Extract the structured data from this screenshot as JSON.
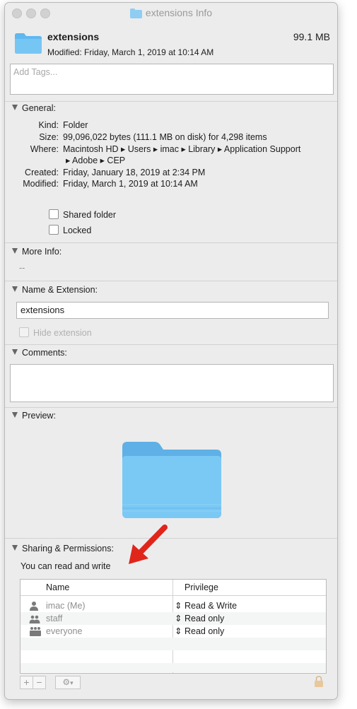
{
  "window": {
    "title": "extensions Info"
  },
  "header": {
    "name": "extensions",
    "size": "99.1 MB",
    "modified": "Modified: Friday, March 1, 2019 at 10:14 AM",
    "tags_placeholder": "Add Tags..."
  },
  "general": {
    "heading": "General:",
    "rows": [
      {
        "label": "Kind:",
        "value": "Folder"
      },
      {
        "label": "Size:",
        "value": "99,096,022 bytes (111.1 MB on disk) for 4,298 items"
      },
      {
        "label": "Where:",
        "value": "Macintosh HD ▸ Users ▸ imac ▸ Library ▸ Application Support",
        "value2": "▸ Adobe ▸ CEP"
      },
      {
        "label": "Created:",
        "value": "Friday, January 18, 2019 at 2:34 PM"
      },
      {
        "label": "Modified:",
        "value": "Friday, March 1, 2019 at 10:14 AM"
      }
    ],
    "shared_folder": "Shared folder",
    "locked": "Locked"
  },
  "more_info": {
    "heading": "More Info:",
    "value": "--"
  },
  "name_ext": {
    "heading": "Name & Extension:",
    "name_value": "extensions",
    "hide_extension": "Hide extension"
  },
  "comments": {
    "heading": "Comments:"
  },
  "preview": {
    "heading": "Preview:"
  },
  "sharing": {
    "heading": "Sharing & Permissions:",
    "summary": "You can read and write",
    "columns": [
      "Name",
      "Privilege"
    ],
    "rows": [
      {
        "name": "imac (Me)",
        "privilege": "Read & Write"
      },
      {
        "name": "staff",
        "privilege": "Read only"
      },
      {
        "name": "everyone",
        "privilege": "Read only"
      }
    ]
  },
  "colors": {
    "folder_blue": "#5fb8ef",
    "arrow_red": "#e0251b"
  }
}
